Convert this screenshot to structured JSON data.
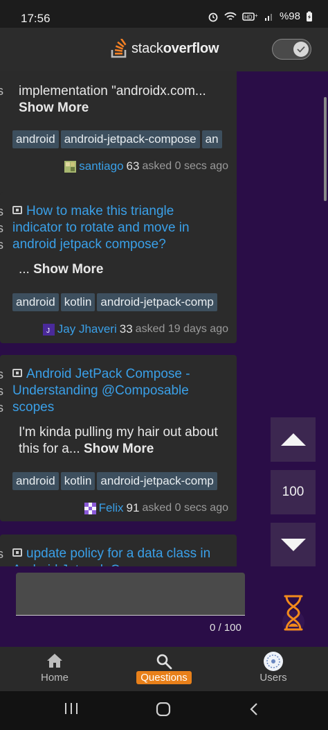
{
  "status_bar": {
    "time": "17:56",
    "battery": "%98"
  },
  "app_bar": {
    "logo_light": "stack",
    "logo_bold": "overflow",
    "theme_toggle": "on"
  },
  "questions": [
    {
      "stats": [
        "s"
      ],
      "title": "",
      "excerpt": "implementation \"androidx.com...",
      "show_more": "Show More",
      "tags": [
        "android",
        "android-jetpack-compose",
        "an"
      ],
      "owner_name": "santiago",
      "owner_rep": "63",
      "asked": "asked 0 secs ago"
    },
    {
      "stats": [
        "s",
        "s",
        "s"
      ],
      "title": "How to make this triangle indicator to rotate and move in android jetpack compose?",
      "excerpt": "... ",
      "show_more": "Show More",
      "tags": [
        "android",
        "kotlin",
        "android-jetpack-comp"
      ],
      "owner_name": "Jay Jhaveri",
      "owner_rep": "33",
      "asked": "asked 19 days ago"
    },
    {
      "stats": [
        "s",
        "s",
        "s"
      ],
      "title": "Android JetPack Compose - Understanding @Composable scopes",
      "excerpt": "I'm kinda pulling my hair out about this for a... ",
      "show_more": "Show More",
      "tags": [
        "android",
        "kotlin",
        "android-jetpack-comp"
      ],
      "owner_name": "Felix",
      "owner_rep": "91",
      "asked": "asked 0 secs ago"
    },
    {
      "stats": [
        "s"
      ],
      "title": "update policy for a data class in Android Jetpack Compose",
      "excerpt": "",
      "show_more": "",
      "tags": [],
      "owner_name": "",
      "owner_rep": "",
      "asked": ""
    }
  ],
  "controls": {
    "page_size": "100"
  },
  "input": {
    "counter": "0 / 100"
  },
  "bottom_nav": {
    "items": [
      {
        "label": "Home",
        "icon": "home-icon"
      },
      {
        "label": "Questions",
        "icon": "search-icon",
        "active": true
      },
      {
        "label": "Users",
        "icon": "users-avatar-icon"
      }
    ]
  },
  "colors": {
    "accent": "#e8801a",
    "link": "#3aa0e8",
    "panel": "#2a0d47"
  }
}
